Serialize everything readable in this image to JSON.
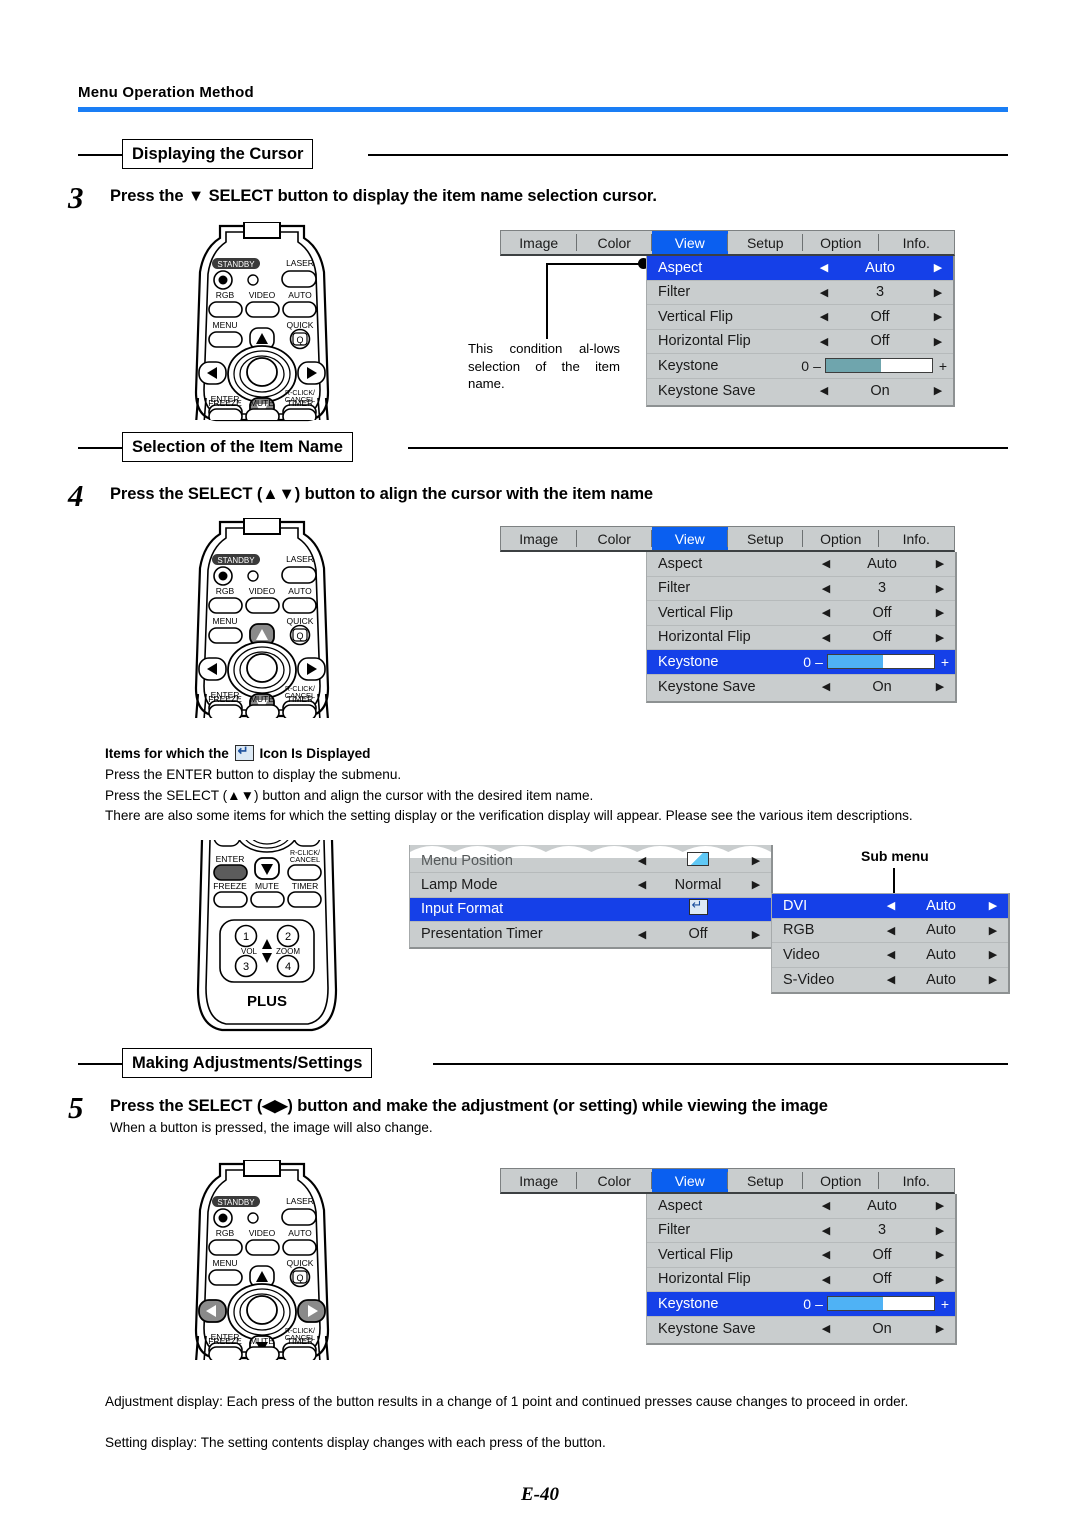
{
  "header": {
    "title": "Menu Operation Method"
  },
  "sections": {
    "displaying_cursor": "Displaying the Cursor",
    "selection_item_name": "Selection of the Item Name",
    "making_adjustments": "Making Adjustments/Settings"
  },
  "steps": {
    "three": {
      "number": "3",
      "text": "Press the ▼ SELECT button to display the item name selection cursor."
    },
    "four": {
      "number": "4",
      "text": "Press the SELECT (▲▼) button to align the cursor with the item name"
    },
    "five": {
      "number": "5",
      "text": "Press the SELECT (◀▶) button and make the adjustment (or setting) while viewing the image",
      "sub": "When a button is pressed, the image will also change."
    }
  },
  "callout": {
    "text": "This condition al-lows selection of the item name."
  },
  "icon_note": {
    "heading_before": "Items for which the",
    "heading_after": "Icon Is Displayed",
    "line1": "Press the ENTER button to display the submenu.",
    "line2": "Press the SELECT (▲▼) button and align the cursor with the desired item name.",
    "line3": "There are also some items for which the setting display or the verification display will appear. Please see the various item descriptions."
  },
  "submenu_label": "Sub menu",
  "footer": {
    "lines": [
      "Adjustment display: Each press of the button results in a change of 1 point and continued presses cause changes to proceed in order.",
      "Setting display: The setting contents display changes with each press of the button."
    ],
    "page": "E-40"
  },
  "osd_tabs": [
    "Image",
    "Color",
    "View",
    "Setup",
    "Option",
    "Info."
  ],
  "osd_active_tab": "View",
  "osd_view_menu": {
    "rows": [
      {
        "label": "Aspect",
        "type": "value",
        "value": "Auto"
      },
      {
        "label": "Filter",
        "type": "value",
        "value": "3"
      },
      {
        "label": "Vertical Flip",
        "type": "value",
        "value": "Off"
      },
      {
        "label": "Horizontal Flip",
        "type": "value",
        "value": "Off"
      },
      {
        "label": "Keystone",
        "type": "slider",
        "value": "0",
        "fill_pct": 52
      },
      {
        "label": "Keystone Save",
        "type": "value",
        "value": "On"
      }
    ],
    "selected_step3": "Aspect",
    "selected_step4": "Keystone",
    "selected_step5": "Keystone"
  },
  "osd_setup_menu": {
    "rows": [
      {
        "label": "Menu Position",
        "type": "icon",
        "value": "position-icon"
      },
      {
        "label": "Lamp Mode",
        "type": "value",
        "value": "Normal"
      },
      {
        "label": "Input Format",
        "type": "enter",
        "value": "enter-icon"
      },
      {
        "label": "Presentation Timer",
        "type": "value",
        "value": "Off"
      }
    ],
    "selected": "Input Format"
  },
  "osd_sub_menu": {
    "rows": [
      {
        "label": "DVI",
        "value": "Auto"
      },
      {
        "label": "RGB",
        "value": "Auto"
      },
      {
        "label": "Video",
        "value": "Auto"
      },
      {
        "label": "S-Video",
        "value": "Auto"
      }
    ],
    "selected": "DVI"
  },
  "remote": {
    "labels": {
      "standby": "STANDBY",
      "laser": "LASER",
      "rgb": "RGB",
      "video": "VIDEO",
      "auto": "AUTO",
      "menu": "MENU",
      "quick": "QUICK",
      "quick_glyph": "Q",
      "enter": "ENTER",
      "rclick1": "R-CLICK/",
      "rclick2": "CANCEL",
      "freeze": "FREEZE",
      "mute": "MUTE",
      "timer": "TIMER",
      "num1": "1",
      "num2": "2",
      "num3": "3",
      "num4": "4",
      "vol": "VOL",
      "zoom": "ZOOM",
      "brand": "PLUS"
    }
  },
  "colors": {
    "accent_blue": "#1a7ef5",
    "osd_select": "#1540e8",
    "osd_tab_active": "#0a5ff0",
    "osd_bg": "#c9cdce",
    "slider_fill": "#6fa5ad",
    "slider_fill_sel": "#4fb2f5"
  }
}
